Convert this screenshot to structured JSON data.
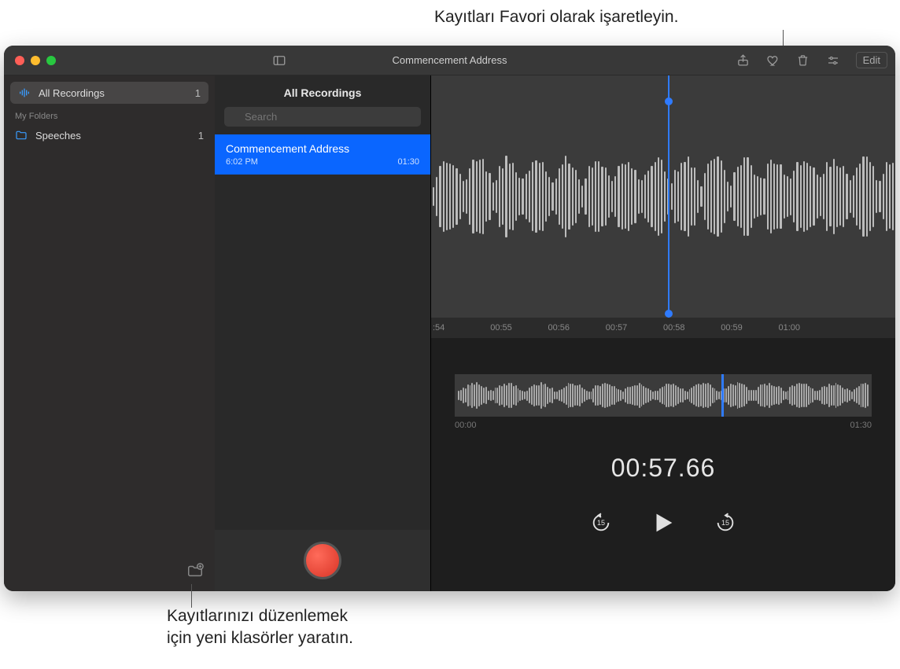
{
  "callouts": {
    "top": "Kayıtları Favori olarak işaretleyin.",
    "bottom_l1": "Kayıtlarınızı düzenlemek",
    "bottom_l2": "için yeni klasörler yaratın."
  },
  "toolbar": {
    "title": "Commencement Address",
    "edit": "Edit"
  },
  "sidebar": {
    "all": {
      "label": "All Recordings",
      "count": "1"
    },
    "header": "My Folders",
    "folders": [
      {
        "label": "Speeches",
        "count": "1"
      }
    ]
  },
  "list": {
    "title": "All Recordings",
    "search_placeholder": "Search",
    "items": [
      {
        "name": "Commencement Address",
        "time": "6:02 PM",
        "duration": "01:30"
      }
    ]
  },
  "player": {
    "ruler": [
      ":54",
      "00:55",
      "00:56",
      "00:57",
      "00:58",
      "00:59",
      "01:00",
      ""
    ],
    "mini_start": "00:00",
    "mini_end": "01:30",
    "timecode": "00:57.66",
    "skip_back": "15",
    "skip_fwd": "15"
  }
}
